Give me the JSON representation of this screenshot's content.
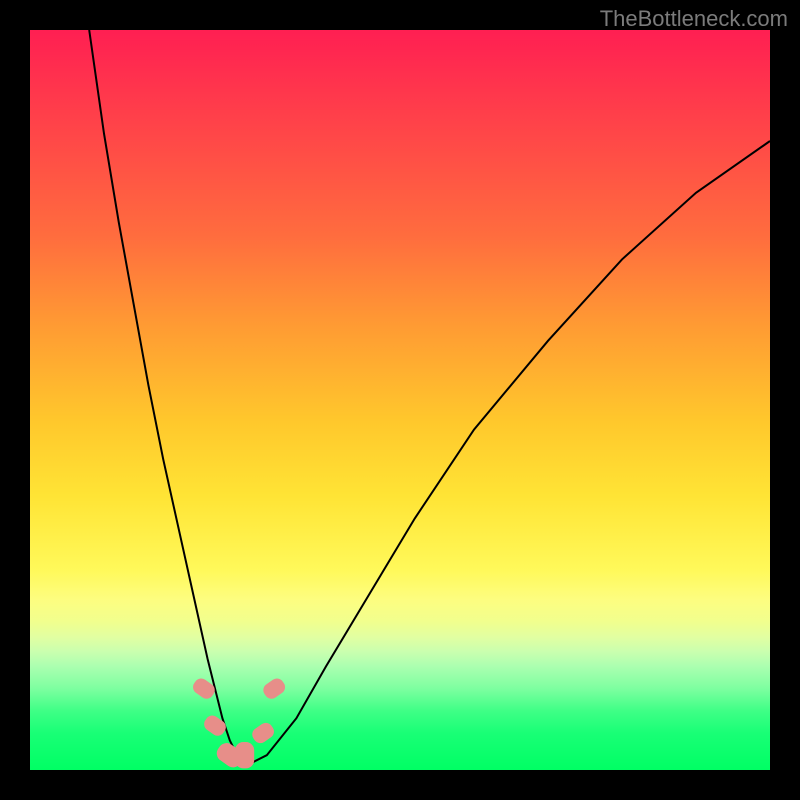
{
  "watermark": "TheBottleneck.com",
  "chart_data": {
    "type": "line",
    "title": "",
    "xlabel": "",
    "ylabel": "",
    "xlim": [
      0,
      100
    ],
    "ylim": [
      0,
      100
    ],
    "grid": false,
    "legend": false,
    "series": [
      {
        "name": "curve",
        "x": [
          8,
          10,
          12,
          14,
          16,
          18,
          20,
          22,
          24,
          25,
          26,
          27,
          28,
          29,
          30,
          32,
          36,
          40,
          46,
          52,
          60,
          70,
          80,
          90,
          100
        ],
        "y": [
          100,
          86,
          74,
          63,
          52,
          42,
          33,
          24,
          15,
          11,
          7,
          4,
          2,
          1,
          1,
          2,
          7,
          14,
          24,
          34,
          46,
          58,
          69,
          78,
          85
        ]
      }
    ],
    "markers": [
      {
        "x": 23.5,
        "y": 11,
        "size": 5
      },
      {
        "x": 25.0,
        "y": 6,
        "size": 5
      },
      {
        "x": 27.0,
        "y": 2,
        "size": 6
      },
      {
        "x": 29.0,
        "y": 2,
        "size": 6
      },
      {
        "x": 31.5,
        "y": 5,
        "size": 5
      },
      {
        "x": 33.0,
        "y": 11,
        "size": 5
      }
    ],
    "colors": {
      "gradient_top": "#ff1f52",
      "gradient_mid": "#fff95a",
      "gradient_bottom": "#00ff64",
      "curve": "#000000",
      "marker": "#e78e89"
    }
  }
}
